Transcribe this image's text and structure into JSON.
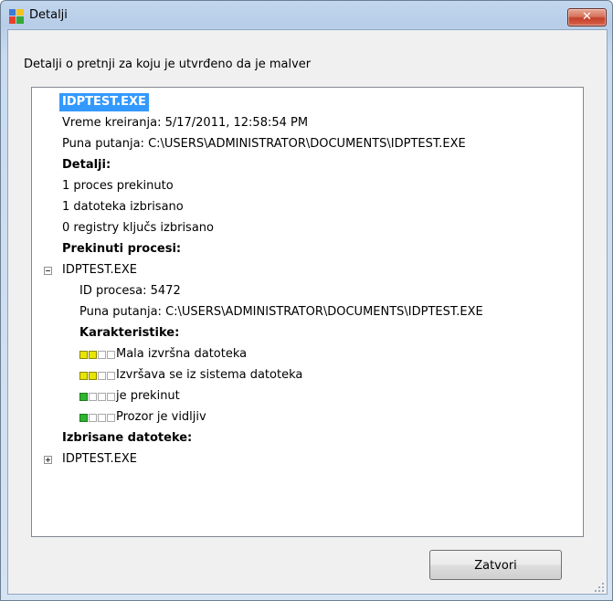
{
  "window": {
    "title": "Detalji",
    "close_glyph": "✕"
  },
  "description": "Detalji o pretnji za koju je utvrđeno da je malver",
  "details": {
    "file_name": "IDPTEST.EXE",
    "created": "Vreme kreiranja: 5/17/2011, 12:58:54 PM",
    "full_path": "Puna putanja: C:\\USERS\\ADMINISTRATOR\\DOCUMENTS\\IDPTEST.EXE",
    "details_heading": "Detalji:",
    "stats": [
      "1 proces prekinuto",
      "1 datoteka izbrisano",
      "0 registry ključs izbrisano"
    ],
    "terminated_heading": "Prekinuti procesi:",
    "process": {
      "name": "IDPTEST.EXE",
      "pid": "ID procesa: 5472",
      "path": "Puna putanja: C:\\USERS\\ADMINISTRATOR\\DOCUMENTS\\IDPTEST.EXE",
      "characteristics_heading": "Karakteristike:",
      "characteristics": [
        {
          "label": "Mala izvršna datoteka",
          "level": 2,
          "color": "#e9e400"
        },
        {
          "label": "Izvršava se iz sistema datoteka",
          "level": 2,
          "color": "#e9e400"
        },
        {
          "label": "je prekinut",
          "level": 1,
          "color": "#2fb52f"
        },
        {
          "label": "Prozor je vidljiv",
          "level": 1,
          "color": "#2fb52f"
        }
      ]
    },
    "deleted_heading": "Izbrisane datoteke:",
    "deleted_file": "IDPTEST.EXE"
  },
  "buttons": {
    "close_label": "Zatvori"
  }
}
